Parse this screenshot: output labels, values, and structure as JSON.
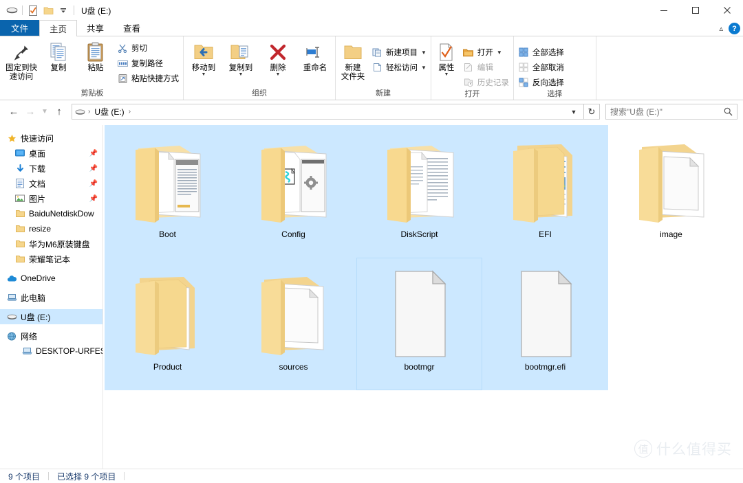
{
  "window": {
    "title": "U盘 (E:)",
    "quick_access_icons": [
      "drive-icon",
      "properties-icon",
      "new-folder-icon",
      "customize-qat-icon"
    ],
    "controls": {
      "minimize": "minimize-icon",
      "maximize": "maximize-icon",
      "close": "close-icon"
    }
  },
  "tabs": [
    {
      "id": "file",
      "label": "文件"
    },
    {
      "id": "home",
      "label": "主页"
    },
    {
      "id": "share",
      "label": "共享"
    },
    {
      "id": "view",
      "label": "查看"
    }
  ],
  "tabs_right": {
    "collapse": "chevron-up-icon",
    "help": "?"
  },
  "ribbon": {
    "groups": [
      {
        "id": "clipboard",
        "label": "剪贴板",
        "big_buttons": [
          {
            "id": "pin-to-quick-access",
            "label": "固定到快\n速访问",
            "label_lines": [
              "固定到快",
              "速访问"
            ],
            "icon": "pin-icon"
          },
          {
            "id": "copy",
            "label": "复制",
            "icon": "copy-icon"
          },
          {
            "id": "paste",
            "label": "粘贴",
            "icon": "paste-icon"
          }
        ],
        "small_buttons": [
          {
            "id": "cut",
            "label": "剪切",
            "icon": "scissors-icon"
          },
          {
            "id": "copy-path",
            "label": "复制路径",
            "icon": "copy-path-icon"
          },
          {
            "id": "paste-shortcut",
            "label": "粘贴快捷方式",
            "icon": "paste-shortcut-icon"
          }
        ]
      },
      {
        "id": "organize",
        "label": "组织",
        "big_buttons": [
          {
            "id": "move-to",
            "label": "移动到",
            "icon": "move-to-icon",
            "has_caret": true
          },
          {
            "id": "copy-to",
            "label": "复制到",
            "icon": "copy-to-icon",
            "has_caret": true
          },
          {
            "id": "delete",
            "label": "删除",
            "icon": "delete-x-icon",
            "has_caret": true
          },
          {
            "id": "rename",
            "label": "重命名",
            "icon": "rename-icon"
          }
        ],
        "small_buttons": []
      },
      {
        "id": "new",
        "label": "新建",
        "big_buttons": [
          {
            "id": "new-folder",
            "label": "新建\n文件夹",
            "label_lines": [
              "新建",
              "文件夹"
            ],
            "icon": "new-folder-icon"
          }
        ],
        "small_buttons": [
          {
            "id": "new-item",
            "label": "新建项目",
            "icon": "new-item-icon",
            "has_caret": true
          },
          {
            "id": "easy-access",
            "label": "轻松访问",
            "icon": "easy-access-icon",
            "has_caret": true
          }
        ]
      },
      {
        "id": "open",
        "label": "打开",
        "big_buttons": [
          {
            "id": "properties",
            "label": "属性",
            "icon": "properties-check-icon",
            "has_caret": true
          }
        ],
        "small_buttons": [
          {
            "id": "open",
            "label": "打开",
            "icon": "open-folder-icon",
            "has_caret": true,
            "disabled": false
          },
          {
            "id": "edit",
            "label": "编辑",
            "icon": "edit-icon",
            "disabled": true
          },
          {
            "id": "history",
            "label": "历史记录",
            "icon": "history-icon",
            "disabled": true
          }
        ]
      },
      {
        "id": "select",
        "label": "选择",
        "big_buttons": [],
        "small_buttons": [
          {
            "id": "select-all",
            "label": "全部选择",
            "icon": "select-all-icon"
          },
          {
            "id": "select-none",
            "label": "全部取消",
            "icon": "select-none-icon"
          },
          {
            "id": "invert-selection",
            "label": "反向选择",
            "icon": "invert-selection-icon"
          }
        ]
      }
    ]
  },
  "addressbar": {
    "back": "back-arrow-icon",
    "forward": "forward-arrow-icon",
    "recent": "chevron-down-icon",
    "up": "up-arrow-icon",
    "breadcrumb": [
      {
        "icon": "drive-icon",
        "label": ""
      },
      {
        "icon": "",
        "label": "U盘 (E:)"
      }
    ],
    "refresh": "refresh-icon",
    "dropdown": "chevron-down-icon",
    "search_placeholder": "搜索\"U盘 (E:)\"",
    "search_value": "",
    "search_icon": "search-icon"
  },
  "navpane": {
    "items": [
      {
        "id": "quick-access",
        "label": "快速访问",
        "icon": "star-icon",
        "indent": 0,
        "pinned": false,
        "selected": false
      },
      {
        "id": "desktop",
        "label": "桌面",
        "icon": "desktop-icon",
        "indent": 1,
        "pinned": true,
        "selected": false
      },
      {
        "id": "downloads",
        "label": "下载",
        "icon": "download-icon",
        "indent": 1,
        "pinned": true,
        "selected": false
      },
      {
        "id": "documents",
        "label": "文档",
        "icon": "document-icon",
        "indent": 1,
        "pinned": true,
        "selected": false
      },
      {
        "id": "pictures",
        "label": "图片",
        "icon": "picture-icon",
        "indent": 1,
        "pinned": true,
        "selected": false
      },
      {
        "id": "baidunetdisk",
        "label": "BaiduNetdiskDow",
        "icon": "folder-icon",
        "indent": 1,
        "pinned": false,
        "selected": false
      },
      {
        "id": "resize",
        "label": "resize",
        "icon": "folder-icon",
        "indent": 1,
        "pinned": false,
        "selected": false
      },
      {
        "id": "huawei-m6-keyboard",
        "label": "华为M6原装键盘",
        "icon": "folder-icon",
        "indent": 1,
        "pinned": false,
        "selected": false
      },
      {
        "id": "honor-notebook",
        "label": "荣耀笔记本",
        "icon": "folder-icon",
        "indent": 1,
        "pinned": false,
        "selected": false
      },
      {
        "id": "onedrive",
        "label": "OneDrive",
        "icon": "cloud-icon",
        "indent": 0,
        "pinned": false,
        "selected": false
      },
      {
        "id": "this-pc",
        "label": "此电脑",
        "icon": "pc-icon",
        "indent": 0,
        "pinned": false,
        "selected": false
      },
      {
        "id": "usb-drive",
        "label": "U盘 (E:)",
        "icon": "drive-icon",
        "indent": 0,
        "pinned": false,
        "selected": true
      },
      {
        "id": "network",
        "label": "网络",
        "icon": "network-icon",
        "indent": 0,
        "pinned": false,
        "selected": false
      },
      {
        "id": "desktop-urfesp",
        "label": "DESKTOP-URFESP",
        "icon": "pc-icon",
        "indent": 1,
        "pinned": false,
        "selected": false
      }
    ]
  },
  "files": [
    {
      "id": "boot",
      "name": "Boot",
      "type": "folder",
      "icon": "folder-with-document-icon",
      "selected": true
    },
    {
      "id": "config",
      "name": "Config",
      "type": "folder",
      "icon": "folder-with-settings-icon",
      "selected": true
    },
    {
      "id": "diskscript",
      "name": "DiskScript",
      "type": "folder",
      "icon": "folder-with-documents-icon",
      "selected": true
    },
    {
      "id": "efi",
      "name": "EFI",
      "type": "folder",
      "icon": "folder-with-media-icon",
      "selected": true
    },
    {
      "id": "image",
      "name": "image",
      "type": "folder",
      "icon": "folder-with-page-icon",
      "selected": false
    },
    {
      "id": "product",
      "name": "Product",
      "type": "folder",
      "icon": "folder-with-media-icon",
      "selected": true
    },
    {
      "id": "sources",
      "name": "sources",
      "type": "folder",
      "icon": "folder-with-page-icon",
      "selected": true
    },
    {
      "id": "bootmgr",
      "name": "bootmgr",
      "type": "file",
      "icon": "generic-file-icon",
      "selected": true
    },
    {
      "id": "bootmgr-efi",
      "name": "bootmgr.efi",
      "type": "file",
      "icon": "generic-file-icon",
      "selected": true
    }
  ],
  "statusbar": {
    "item_count": "9 个项目",
    "selection": "已选择 9 个项目"
  },
  "watermark": {
    "badge": "值",
    "text": "什么值得买"
  },
  "colors": {
    "accent": "#0a64ad",
    "selection": "#cce8ff",
    "folder": "#fcd88a",
    "status_text": "#1c3d6e",
    "help_blue": "#0a7ad0"
  }
}
